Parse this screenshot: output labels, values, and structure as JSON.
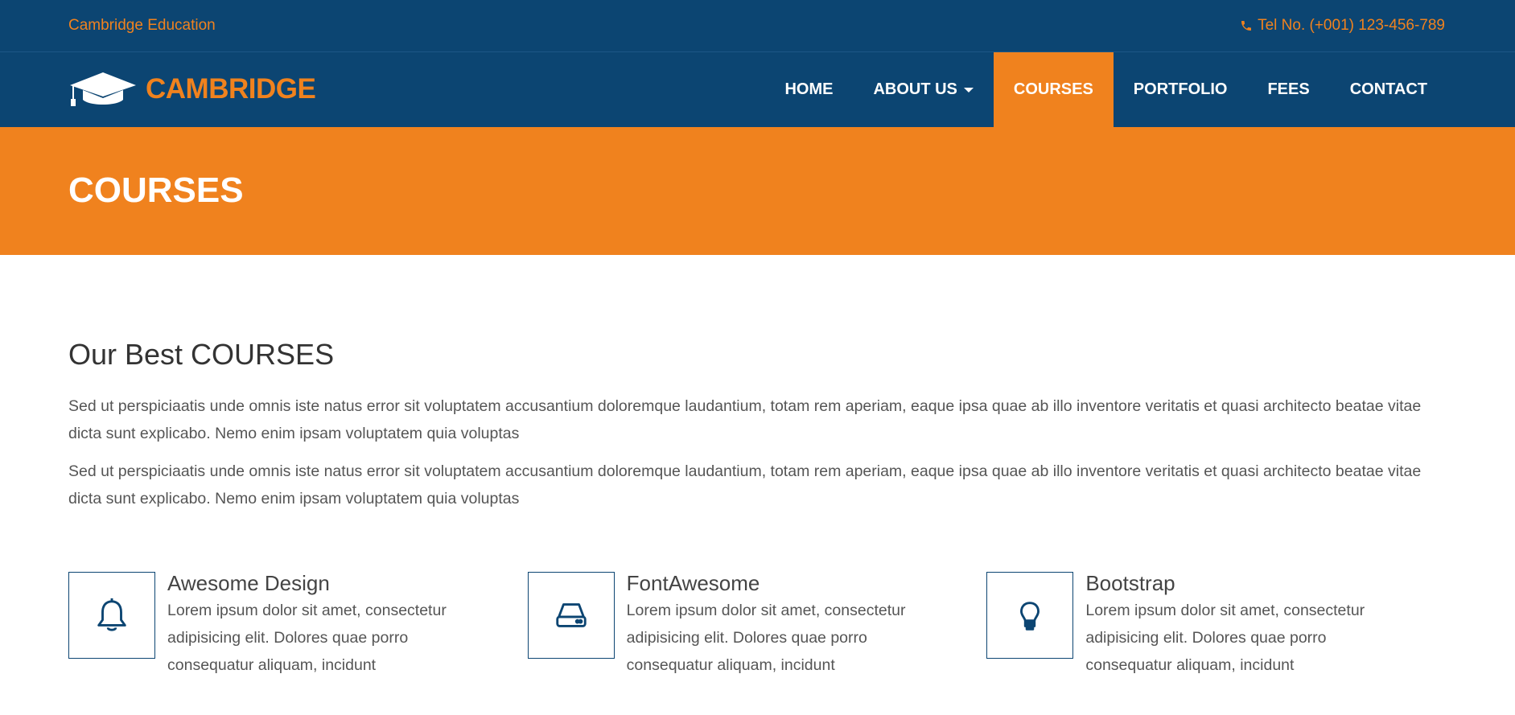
{
  "topbar": {
    "brand": "Cambridge Education",
    "phone": "Tel No. (+001) 123-456-789"
  },
  "navbar": {
    "logo_text": "CAMBRIDGE",
    "items": [
      {
        "label": "HOME"
      },
      {
        "label": "ABOUT US"
      },
      {
        "label": "COURSES"
      },
      {
        "label": "PORTFOLIO"
      },
      {
        "label": "FEES"
      },
      {
        "label": "CONTACT"
      }
    ],
    "active": "COURSES"
  },
  "banner": {
    "title": "COURSES"
  },
  "main": {
    "heading": "Our Best COURSES",
    "paragraphs": [
      "Sed ut perspiciaatis unde omnis iste natus error sit voluptatem accusantium doloremque laudantium, totam rem aperiam, eaque ipsa quae ab illo inventore veritatis et quasi architecto beatae vitae dicta sunt explicabo. Nemo enim ipsam voluptatem quia voluptas",
      "Sed ut perspiciaatis unde omnis iste natus error sit voluptatem accusantium doloremque laudantium, totam rem aperiam, eaque ipsa quae ab illo inventore veritatis et quasi architecto beatae vitae dicta sunt explicabo. Nemo enim ipsam voluptatem quia voluptas"
    ]
  },
  "features": [
    {
      "icon": "bell-icon",
      "title": "Awesome Design",
      "text": "Lorem ipsum dolor sit amet, consectetur adipisicing elit. Dolores quae porro consequatur aliquam, incidunt"
    },
    {
      "icon": "hard-drive-icon",
      "title": "FontAwesome",
      "text": "Lorem ipsum dolor sit amet, consectetur adipisicing elit. Dolores quae porro consequatur aliquam, incidunt"
    },
    {
      "icon": "lightbulb-icon",
      "title": "Bootstrap",
      "text": "Lorem ipsum dolor sit amet, consectetur adipisicing elit. Dolores quae porro consequatur aliquam, incidunt"
    }
  ],
  "colors": {
    "primary": "#0c4572",
    "accent": "#f0821e",
    "text": "#555555"
  }
}
